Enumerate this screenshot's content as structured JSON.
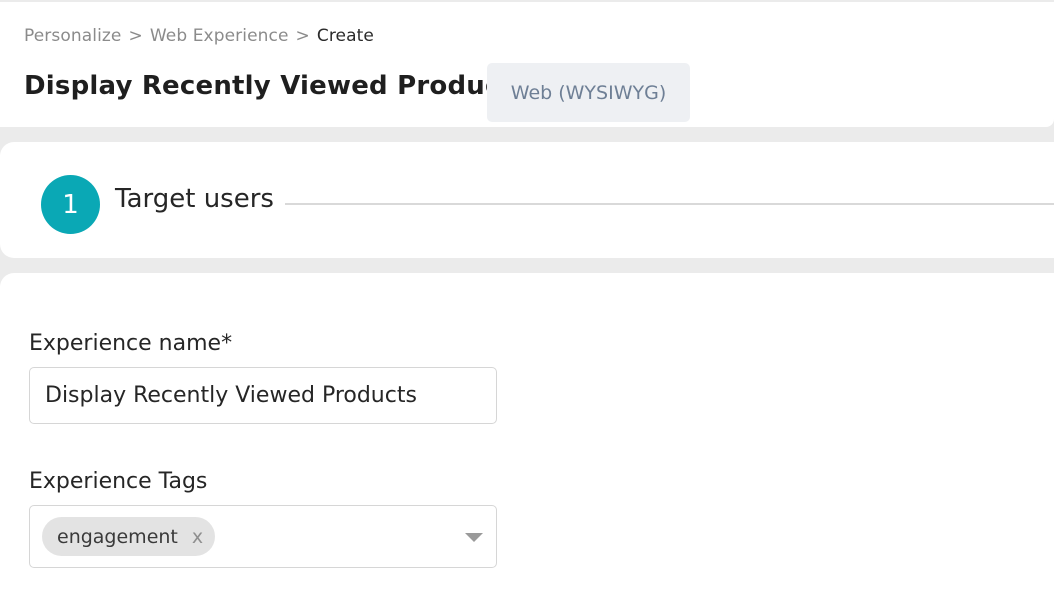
{
  "breadcrumb": {
    "items": [
      "Personalize",
      "Web Experience"
    ],
    "separator": ">",
    "current": "Create"
  },
  "header": {
    "title": "Display Recently Viewed Products",
    "type_badge": "Web (WYSIWYG)"
  },
  "steps": [
    {
      "number": "1",
      "label": "Target users",
      "active": true,
      "color": "#0aa8b5"
    }
  ],
  "form": {
    "experience_name": {
      "label": "Experience name*",
      "value": "Display Recently Viewed Products"
    },
    "experience_tags": {
      "label": "Experience Tags",
      "tags": [
        {
          "label": "engagement",
          "remove_glyph": "x"
        }
      ],
      "dropdown_icon": "chevron-down-icon"
    }
  }
}
